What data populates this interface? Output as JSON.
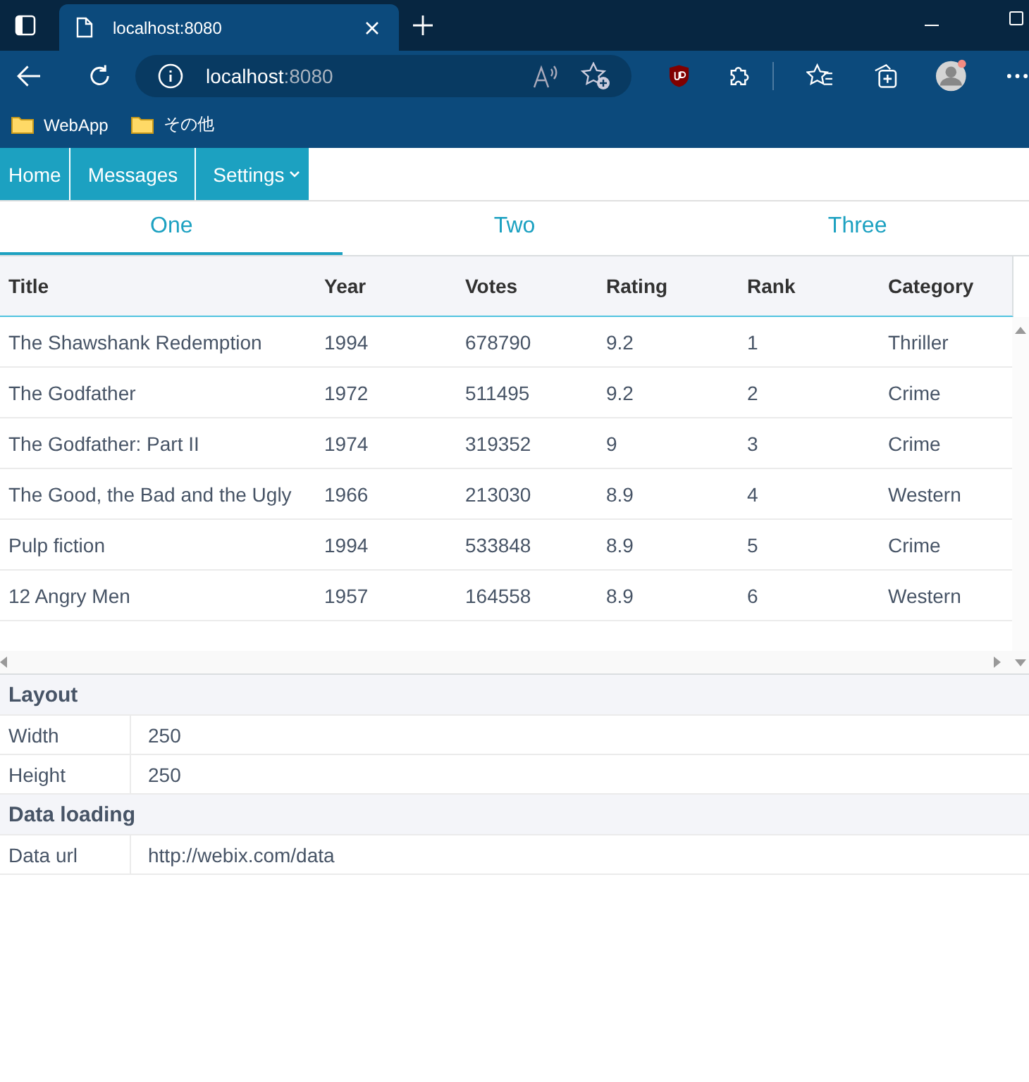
{
  "browser": {
    "tabs": [
      {
        "title": "localhost:8080",
        "selected": true
      }
    ],
    "address": {
      "host": "localhost",
      "port": ":8080"
    },
    "bookmarks": [
      {
        "label": "WebApp"
      },
      {
        "label": "その他"
      }
    ]
  },
  "menu": [
    {
      "label": "Home",
      "has_submenu": false
    },
    {
      "label": "Messages",
      "has_submenu": false
    },
    {
      "label": "Settings",
      "has_submenu": true
    }
  ],
  "tabs": [
    {
      "label": "One",
      "selected": true
    },
    {
      "label": "Two",
      "selected": false
    },
    {
      "label": "Three",
      "selected": false
    }
  ],
  "table": {
    "columns": [
      "Title",
      "Year",
      "Votes",
      "Rating",
      "Rank",
      "Category"
    ],
    "rows": [
      [
        "The Shawshank Redemption",
        "1994",
        "678790",
        "9.2",
        "1",
        "Thriller"
      ],
      [
        "The Godfather",
        "1972",
        "511495",
        "9.2",
        "2",
        "Crime"
      ],
      [
        "The Godfather: Part II",
        "1974",
        "319352",
        "9",
        "3",
        "Crime"
      ],
      [
        "The Good, the Bad and the Ugly",
        "1966",
        "213030",
        "8.9",
        "4",
        "Western"
      ],
      [
        "Pulp fiction",
        "1994",
        "533848",
        "8.9",
        "5",
        "Crime"
      ],
      [
        "12 Angry Men",
        "1957",
        "164558",
        "8.9",
        "6",
        "Western"
      ]
    ]
  },
  "properties": [
    {
      "title": "Layout",
      "items": [
        {
          "label": "Width",
          "value": "250"
        },
        {
          "label": "Height",
          "value": "250"
        }
      ]
    },
    {
      "title": "Data loading",
      "items": [
        {
          "label": "Data url",
          "value": "http://webix.com/data"
        }
      ]
    }
  ]
}
